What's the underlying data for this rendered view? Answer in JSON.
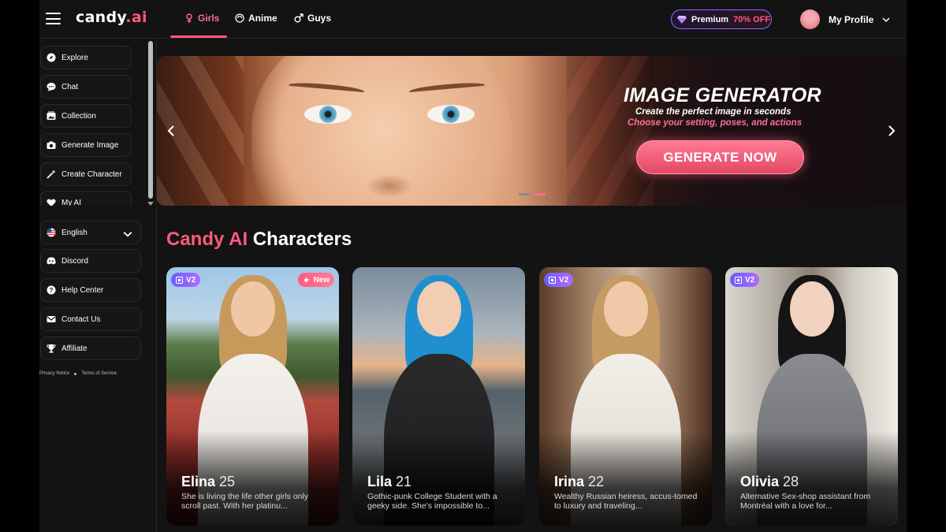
{
  "header": {
    "logo_main": "candy",
    "logo_dot": ".ai",
    "tabs": [
      {
        "label": "Girls",
        "icon": "female-icon",
        "active": true
      },
      {
        "label": "Anime",
        "icon": "anime-icon",
        "active": false
      },
      {
        "label": "Guys",
        "icon": "male-icon",
        "active": false
      }
    ],
    "premium": {
      "label": "Premium",
      "discount": "70% OFF"
    },
    "profile_label": "My Profile"
  },
  "sidebar": {
    "items": [
      {
        "label": "Explore",
        "icon": "compass-icon"
      },
      {
        "label": "Chat",
        "icon": "chat-bubble-icon"
      },
      {
        "label": "Collection",
        "icon": "collection-icon"
      },
      {
        "label": "Generate Image",
        "icon": "camera-icon"
      },
      {
        "label": "Create Character",
        "icon": "magic-wand-icon"
      },
      {
        "label": "My AI",
        "icon": "heart-icon"
      }
    ],
    "language": {
      "label": "English",
      "icon": "us-flag-icon"
    },
    "links": [
      {
        "label": "Discord",
        "icon": "discord-icon"
      },
      {
        "label": "Help Center",
        "icon": "help-icon"
      },
      {
        "label": "Contact Us",
        "icon": "mail-icon"
      },
      {
        "label": "Affiliate",
        "icon": "trophy-icon"
      }
    ],
    "legal": {
      "privacy": "Privacy Notice",
      "terms": "Terms of Service"
    }
  },
  "banner": {
    "title": "IMAGE GENERATOR",
    "subtitle": "Create the perfect image in seconds",
    "tagline": "Choose your setting, poses, and actions",
    "button": "GENERATE NOW",
    "slide_count": 2,
    "active_slide": 2
  },
  "section": {
    "title_accent": "Candy AI",
    "title_rest": "Characters"
  },
  "cards": [
    {
      "name": "Elina",
      "age": "25",
      "desc": "She is living the life other girls only scroll past. With her platinu...",
      "badge_v2": "V2",
      "badge_new": "New"
    },
    {
      "name": "Lila",
      "age": "21",
      "desc": "Gothic-punk College Student with a geeky side. She's impossible to...",
      "badge_v2": "",
      "badge_new": ""
    },
    {
      "name": "Irina",
      "age": "22",
      "desc": "Wealthy Russian heiress, accus-tomed to luxury and traveling...",
      "badge_v2": "V2",
      "badge_new": ""
    },
    {
      "name": "Olivia",
      "age": "28",
      "desc": "Alternative Sex-shop assistant from Montréal with a love for...",
      "badge_v2": "V2",
      "badge_new": ""
    }
  ],
  "colors": {
    "accent": "#ff5a7e",
    "background": "#131313",
    "v2_badge": "#8a64ff"
  }
}
